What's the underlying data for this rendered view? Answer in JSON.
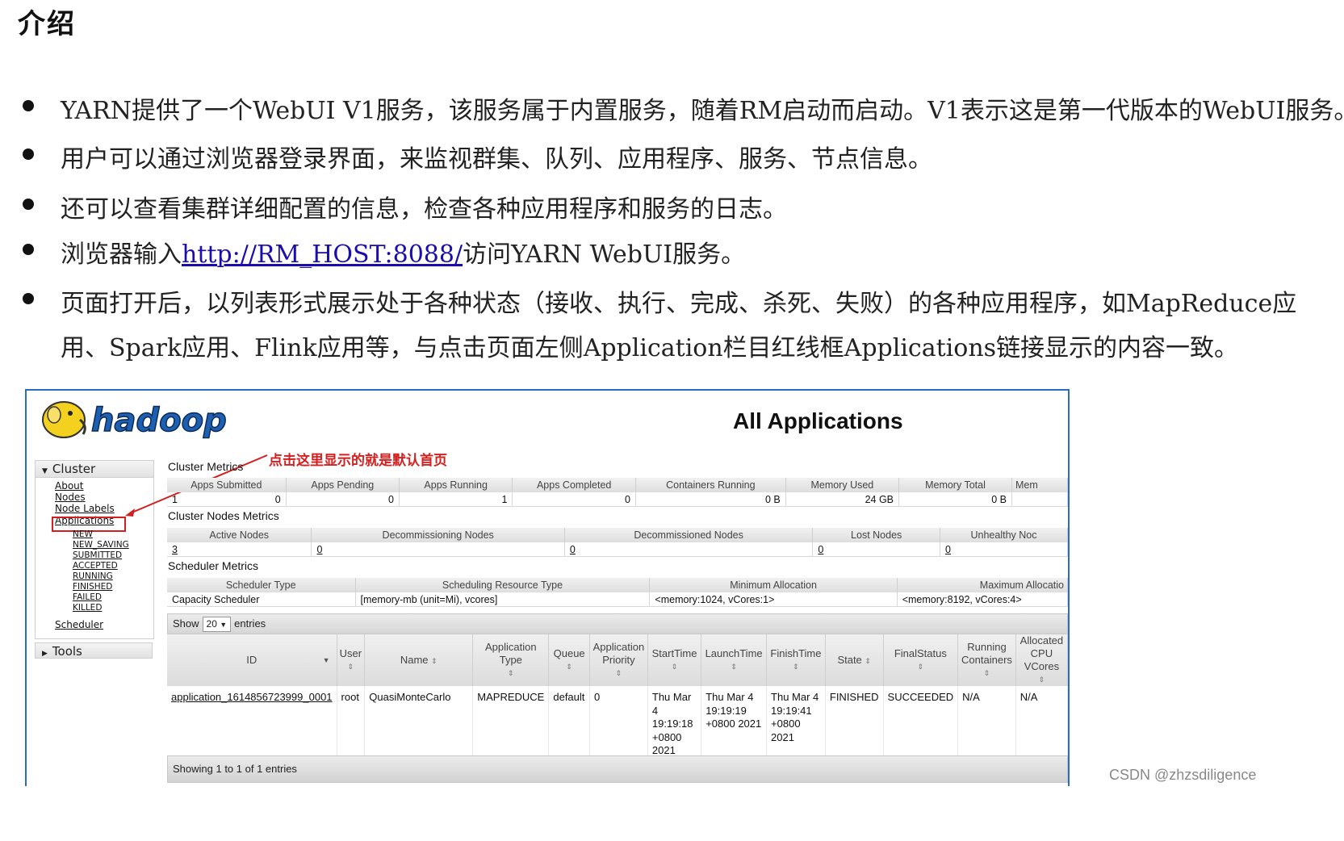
{
  "heading": "介绍",
  "bullets": [
    {
      "parts": [
        {
          "t": "YARN",
          "m": true
        },
        {
          "t": "提供了一个"
        },
        {
          "t": "WebUI V1",
          "m": true
        },
        {
          "t": "服务，该服务属于内置服务，随着"
        },
        {
          "t": "RM",
          "m": true
        },
        {
          "t": "启动而启动。"
        },
        {
          "t": "V1",
          "m": true
        },
        {
          "t": "表示这是第一代版本的"
        },
        {
          "t": "WebUI",
          "m": true
        },
        {
          "t": "服务。"
        }
      ]
    },
    {
      "parts": [
        {
          "t": "用户可以通过浏览器登录界面，来监视群集、队列、应用程序、服务、节点信息。"
        }
      ]
    },
    {
      "parts": [
        {
          "t": "还可以查看集群详细配置的信息，检查各种应用程序和服务的日志。"
        }
      ]
    },
    {
      "parts": [
        {
          "t": "浏览器输入"
        },
        {
          "t": "http://RM_HOST:8088/",
          "link": true
        },
        {
          "t": "访问"
        },
        {
          "t": "YARN WebUI",
          "m": true
        },
        {
          "t": "服务。"
        }
      ]
    },
    {
      "parts": [
        {
          "t": "页面打开后，以列表形式展示处于各种状态（接收、执行、完成、杀死、失败）的各种应用程序，如"
        },
        {
          "t": "MapReduce",
          "m": true
        },
        {
          "t": "应"
        }
      ]
    },
    {
      "parts": [
        {
          "t": "用、"
        },
        {
          "t": "Spark",
          "m": true
        },
        {
          "t": "应用、"
        },
        {
          "t": "Flink",
          "m": true
        },
        {
          "t": "应用等，与点击页面左侧"
        },
        {
          "t": "Application",
          "m": true
        },
        {
          "t": "栏目红线框"
        },
        {
          "t": "Applications",
          "m": true
        },
        {
          "t": "链接显示的内容一致。"
        }
      ]
    }
  ],
  "ui": {
    "logo_text": "hadoop",
    "page_title": "All Applications",
    "annotation": "点击这里显示的就是默认首页",
    "sidebar": {
      "cluster": "Cluster",
      "links": [
        "About",
        "Nodes",
        "Node Labels",
        "Applications"
      ],
      "states": [
        "NEW",
        "NEW_SAVING",
        "SUBMITTED",
        "ACCEPTED",
        "RUNNING",
        "FINISHED",
        "FAILED",
        "KILLED"
      ],
      "scheduler": "Scheduler",
      "tools": "Tools"
    },
    "cluster_metrics": {
      "label": "Cluster Metrics",
      "headers": [
        "Apps Submitted",
        "Apps Pending",
        "Apps Running",
        "Apps Completed",
        "Containers Running",
        "Memory Used",
        "Memory Total",
        "Mem"
      ],
      "values": [
        "1",
        "0",
        "0",
        "1",
        "0",
        "0 B",
        "24 GB",
        "0 B"
      ]
    },
    "nodes_metrics": {
      "label": "Cluster Nodes Metrics",
      "headers": [
        "Active Nodes",
        "Decommissioning Nodes",
        "Decommissioned Nodes",
        "Lost Nodes",
        "Unhealthy Noc"
      ],
      "values": [
        "3",
        "0",
        "0",
        "0",
        "0"
      ]
    },
    "scheduler_metrics": {
      "label": "Scheduler Metrics",
      "headers": [
        "Scheduler Type",
        "Scheduling Resource Type",
        "Minimum Allocation",
        "Maximum Allocatio"
      ],
      "values": [
        "Capacity Scheduler",
        "[memory-mb (unit=Mi), vcores]",
        "<memory:1024, vCores:1>",
        "<memory:8192, vCores:4>"
      ]
    },
    "show": {
      "prefix": "Show",
      "value": "20",
      "suffix": "entries"
    },
    "apps_table": {
      "headers": [
        "ID",
        "User",
        "Name",
        "Application Type",
        "Queue",
        "Application Priority",
        "StartTime",
        "LaunchTime",
        "FinishTime",
        "State",
        "FinalStatus",
        "Running Containers",
        "Allocated CPU VCores"
      ],
      "row": [
        "application_1614856723999_0001",
        "root",
        "QuasiMonteCarlo",
        "MAPREDUCE",
        "default",
        "0",
        "Thu Mar 4 19:19:18 +0800 2021",
        "Thu Mar 4 19:19:19 +0800 2021",
        "Thu Mar 4 19:19:41 +0800 2021",
        "FINISHED",
        "SUCCEEDED",
        "N/A",
        "N/A"
      ]
    },
    "footer": "Showing 1 to 1 of 1 entries"
  },
  "watermark": "CSDN @zhzsdiligence",
  "colors": {
    "annotation": "#d21f1f",
    "link": "#1a0dab",
    "frame": "#2a6cc4"
  }
}
